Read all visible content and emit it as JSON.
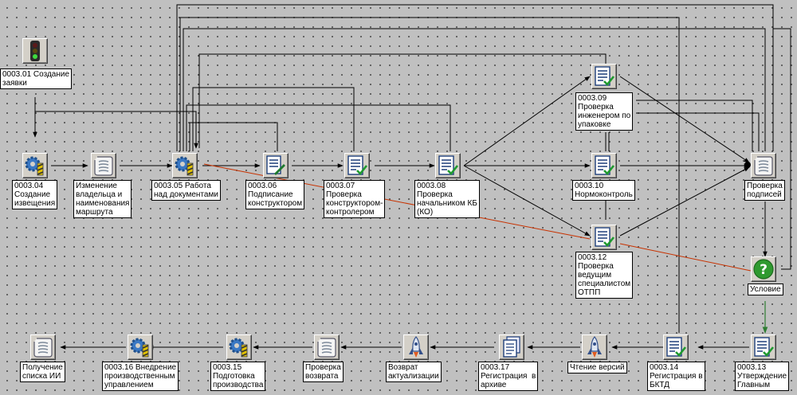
{
  "colors": {
    "canvas": "#c0c0c0",
    "wire": "#000000",
    "highlight_wire": "#c83200",
    "condition_wire": "#2e7d32",
    "condition_icon": "#2f9a2f"
  },
  "nodes": [
    {
      "id": "n01",
      "icon": "traffic-light-icon",
      "label": "0003.01 Создание\nзаявки"
    },
    {
      "id": "n04",
      "icon": "gear-task-icon",
      "label": "0003.04\nСоздание\nизвещения"
    },
    {
      "id": "nRoute",
      "icon": "scroll-icon",
      "label": "Изменение\nвладельца и\nнаименования\nмаршрута"
    },
    {
      "id": "n05",
      "icon": "gear-task-icon",
      "label": "0003.05 Работа\nнад документами"
    },
    {
      "id": "n06",
      "icon": "document-sign-icon",
      "label": "0003.06\nПодписание\nконструктором"
    },
    {
      "id": "n07",
      "icon": "document-check-icon",
      "label": "0003.07\nПроверка\nконструктором-\nконтролером"
    },
    {
      "id": "n08",
      "icon": "document-check-icon",
      "label": "0003.08\nПроверка\nначальником КБ\n(КО)"
    },
    {
      "id": "n09",
      "icon": "document-check-icon",
      "label": "0003.09\nПроверка\nинженером по\nупаковке"
    },
    {
      "id": "n10",
      "icon": "document-check-icon",
      "label": "0003.10\nНормоконтроль"
    },
    {
      "id": "n12",
      "icon": "document-check-icon",
      "label": "0003.12\nПроверка\nведущим\nспециалистом\nОТПП"
    },
    {
      "id": "nSig",
      "icon": "scroll-icon",
      "label": "Проверка\nподписей"
    },
    {
      "id": "nCond",
      "icon": "question-icon",
      "label": "Условие"
    },
    {
      "id": "n13",
      "icon": "document-check-icon",
      "label": "0003.13\nУтверждение\nГлавным"
    },
    {
      "id": "n14",
      "icon": "document-check-icon",
      "label": "0003.14\nРегистрация в\nБКТД"
    },
    {
      "id": "nVers",
      "icon": "rocket-icon",
      "label": "Чтение версий"
    },
    {
      "id": "n17",
      "icon": "document-stack-icon",
      "label": "0003.17\nРегистрация  в\nархиве"
    },
    {
      "id": "nActual",
      "icon": "rocket-icon",
      "label": "Возврат\nактуализации"
    },
    {
      "id": "nRet",
      "icon": "scroll-icon",
      "label": "Проверка\nвозврата"
    },
    {
      "id": "n15",
      "icon": "gear-task-icon",
      "label": "0003.15\nПодготовка\nпроизводства"
    },
    {
      "id": "n16",
      "icon": "gear-task-icon",
      "label": "0003.16 Внедрение\nпроизводственным\nуправлением"
    },
    {
      "id": "nList",
      "icon": "scroll-icon",
      "label": "Получение\nсписка ИИ"
    }
  ]
}
